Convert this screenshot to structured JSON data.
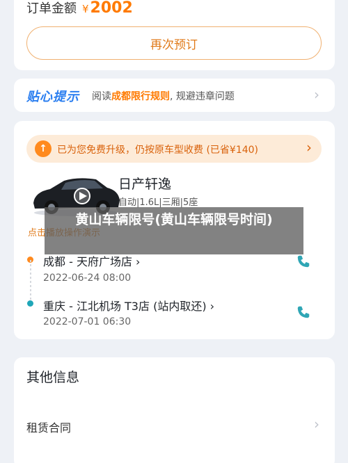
{
  "order": {
    "amount_label": "订单金额",
    "currency": "¥",
    "amount": "2002",
    "rebook_label": "再次预订"
  },
  "tips": {
    "title": "贴心提示",
    "text_before": "阅读",
    "text_highlight": "成都限行规则",
    "text_after": ", 规避违章问题"
  },
  "upgrade": {
    "text": "已为您免费升级，仍按原车型收费 (已省¥140)"
  },
  "car": {
    "name": "日产轩逸",
    "spec": "自动|1.6L|三厢|5座",
    "demo_label": "点击播放操作演示"
  },
  "pickup": {
    "location": "成都 - 天府广场店 ›",
    "time": "2022-06-24 08:00"
  },
  "dropoff": {
    "location": "重庆 - 江北机场 T3店 (站内取还) ›",
    "time": "2022-07-01 06:30"
  },
  "other": {
    "title": "其他信息",
    "lease_label": "租赁合同"
  },
  "overlay": {
    "caption": "黄山车辆限号(黄山车辆限号时间)"
  },
  "colors": {
    "accent": "#ff7a00",
    "brand_blue": "#2a7ef0",
    "teal": "#2fa6b5"
  }
}
